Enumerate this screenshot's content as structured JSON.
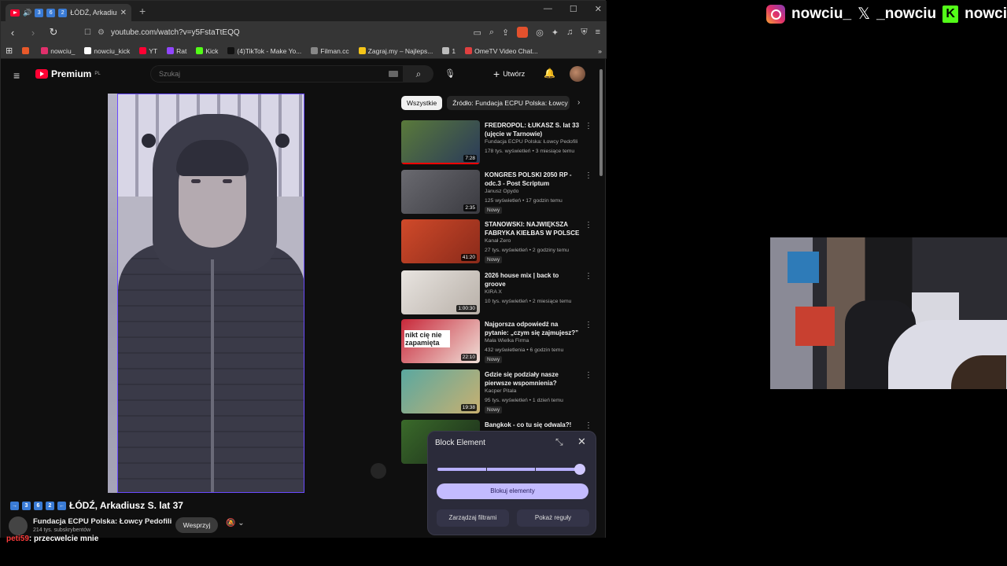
{
  "browser": {
    "tab": {
      "title": "ŁÓDŹ, Arkadiusz S. lat 37",
      "prefix_badges": [
        "3",
        "6",
        "2"
      ]
    },
    "window_controls": {
      "minimize": "—",
      "maximize": "☐",
      "close": "✕"
    },
    "address": "youtube.com/watch?v=y5FstaTtEQQ",
    "bookmarks": [
      {
        "label": "",
        "color": "#e8592a"
      },
      {
        "label": "nowciu_",
        "color": "#e1306c"
      },
      {
        "label": "nowciu_kick",
        "color": "#ffffff"
      },
      {
        "label": "YT",
        "color": "#ff0033"
      },
      {
        "label": "Rat",
        "color": "#9146ff"
      },
      {
        "label": "Kick",
        "color": "#53fc18"
      },
      {
        "label": "(4)TikTok - Make Yo...",
        "color": "#111111"
      },
      {
        "label": "Filman.cc",
        "color": "#888888"
      },
      {
        "label": "Zagraj.my – Najleps...",
        "color": "#f5c518"
      },
      {
        "label": "1",
        "color": "#bbbbbb"
      },
      {
        "label": "OmeTV Video Chat...",
        "color": "#e04040"
      }
    ]
  },
  "youtube": {
    "logo_text": "Premium",
    "logo_region": "PL",
    "search_placeholder": "Szukaj",
    "create_label": "Utwórz",
    "video_title": "ŁÓDŹ, Arkadiusz S. lat 37",
    "title_badges": [
      "3",
      "6",
      "2"
    ],
    "channel": {
      "name": "Fundacja ECPU Polska: Łowcy Pedofili",
      "subs": "214 tys. subskrybentów",
      "support_label": "Wesprzyj"
    },
    "chips": [
      "Wszystkie",
      "Źródło: Fundacja ECPU Polska: Łowcy Pedofili"
    ],
    "recommendations": [
      {
        "title": "FREDROPOL: ŁUKASZ S. lat 33 (ujęcie w Tarnowie)",
        "channel": "Fundacja ECPU Polska: Łowcy Pedofili",
        "meta": "178 tys. wyświetleń • 3 miesiące temu",
        "duration": "7:28",
        "new": "",
        "progress": 1.0,
        "thumb": [
          "#5a7a3a",
          "#2a3a5a"
        ]
      },
      {
        "title": "KONGRES POLSKI 2050 RP - odc.3 - Post Scriptum",
        "channel": "Janusz Opydo",
        "meta": "125 wyświetleń • 17 godzin temu",
        "duration": "2:35",
        "new": "Nowy",
        "progress": 0,
        "thumb": [
          "#6a6a70",
          "#3a3a40"
        ]
      },
      {
        "title": "STANOWSKI: NAJWIĘKSZA FABRYKA KIEŁBAS W POLSCE",
        "channel": "Kanał Zero",
        "meta": "27 tys. wyświetleń • 2 godziny temu",
        "duration": "41:20",
        "new": "Nowy",
        "progress": 0,
        "thumb": [
          "#d04a2a",
          "#8a2a1a"
        ]
      },
      {
        "title": "2026 house mix | back to groove",
        "channel": "KIRA X",
        "meta": "10 tys. wyświetleń • 2 miesiące temu",
        "duration": "1:00:30",
        "new": "",
        "progress": 0,
        "thumb": [
          "#e8e4e0",
          "#b8b0a8"
        ]
      },
      {
        "title": "Najgorsza odpowiedź na pytanie: „czym się zajmujesz?”",
        "channel": "Mała Wielka Firma",
        "meta": "432 wyświetlenia • 6 godzin temu",
        "duration": "22:10",
        "new": "Nowy",
        "progress": 0,
        "thumb": [
          "#c8283a",
          "#f0e0d8"
        ],
        "thumb_text": "nikt cię nie zapamięta"
      },
      {
        "title": "Gdzie się podziały nasze pierwsze wspomnienia?",
        "channel": "Kacper Pitala",
        "meta": "95 tys. wyświetleń • 1 dzień temu",
        "duration": "19:38",
        "new": "Nowy",
        "progress": 0,
        "thumb": [
          "#5aa8a0",
          "#c8b070"
        ]
      },
      {
        "title": "Bangkok - co tu się odwala?!",
        "channel": "",
        "meta": "",
        "duration": "",
        "new": "",
        "progress": 0,
        "thumb": [
          "#3a6a2a",
          "#1a2a1a"
        ]
      }
    ]
  },
  "block_popup": {
    "title": "Block Element",
    "slider_level": 1.0,
    "block_label": "Blokuj elementy",
    "manage_label": "Zarządzaj filtrami",
    "rules_label": "Pokaż reguły"
  },
  "chat": {
    "user": "peti59",
    "message": ": przecwelcie mnie"
  },
  "socials": [
    {
      "icon": "instagram-icon",
      "handle": "nowciu_"
    },
    {
      "icon": "x-icon",
      "handle": "_nowciu"
    },
    {
      "icon": "kick-icon",
      "handle": "nowciu"
    }
  ]
}
